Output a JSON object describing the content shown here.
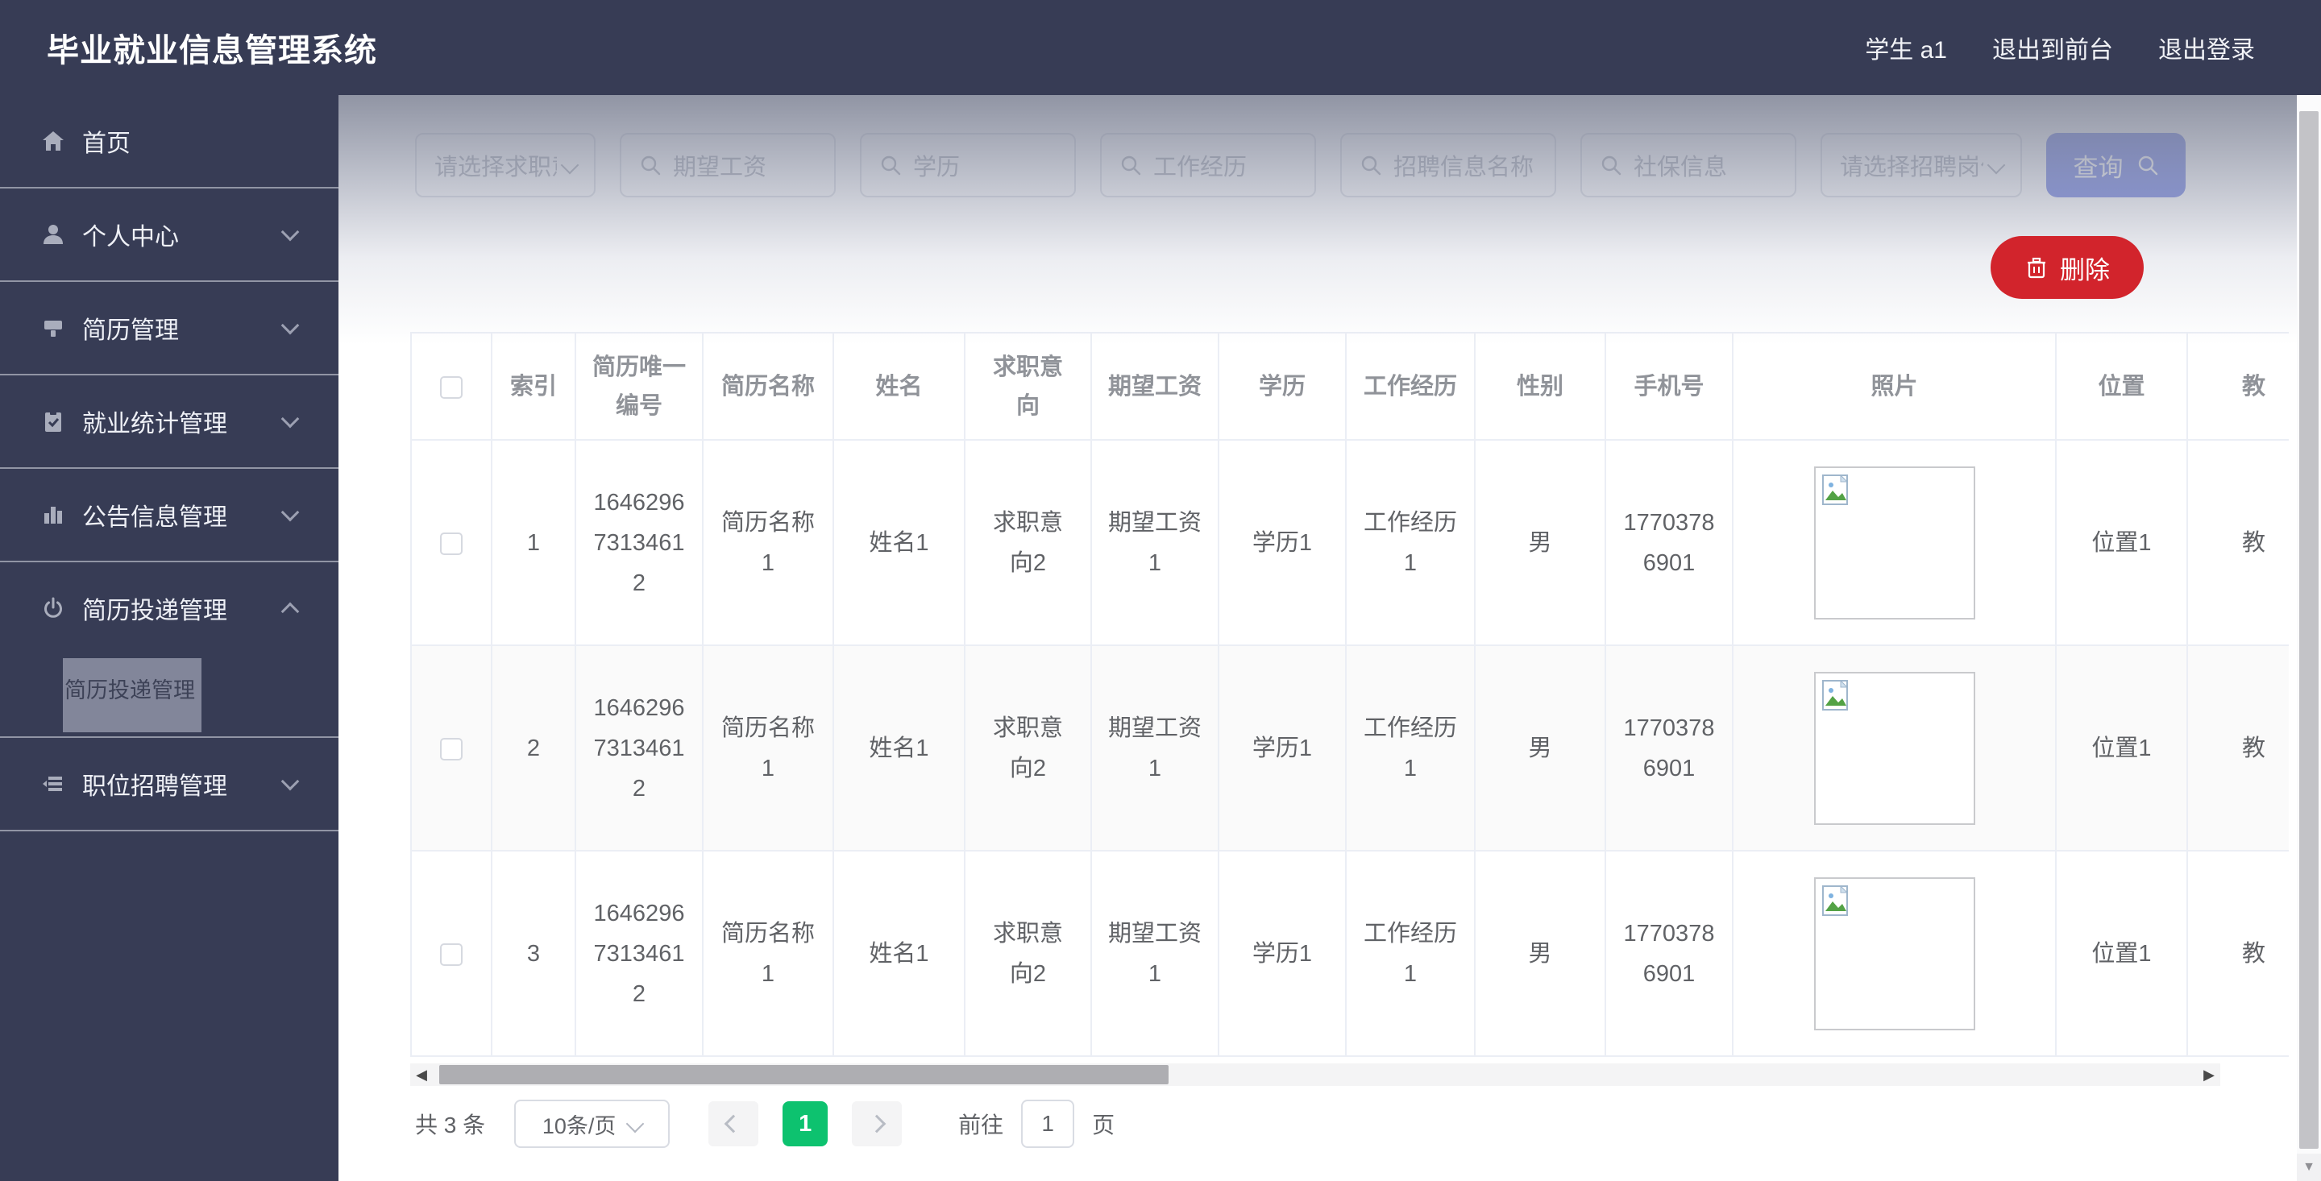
{
  "app_title": "毕业就业信息管理系统",
  "topbar": {
    "user": "学生 a1",
    "to_front": "退出到前台",
    "logout": "退出登录"
  },
  "sidebar": {
    "items": [
      {
        "label": "首页",
        "icon": "home-icon"
      },
      {
        "label": "个人中心",
        "icon": "user-icon"
      },
      {
        "label": "简历管理",
        "icon": "resume-icon"
      },
      {
        "label": "就业统计管理",
        "icon": "clipboard-check-icon"
      },
      {
        "label": "公告信息管理",
        "icon": "bar-chart-icon"
      },
      {
        "label": "简历投递管理",
        "icon": "power-icon",
        "expanded": true,
        "submenu": [
          {
            "label": "简历投递管理",
            "active": true
          }
        ]
      },
      {
        "label": "职位招聘管理",
        "icon": "list-icon"
      }
    ]
  },
  "filters": {
    "job_intent_placeholder": "请选择求职意向",
    "salary_placeholder": "期望工资",
    "education_placeholder": "学历",
    "work_exp_placeholder": "工作经历",
    "recruit_name_placeholder": "招聘信息名称",
    "social_security_placeholder": "社保信息",
    "recruit_post_placeholder": "请选择招聘岗位",
    "query_label": "查询"
  },
  "actions": {
    "delete_label": "删除"
  },
  "table": {
    "columns": [
      "索引",
      "简历唯一编号",
      "简历名称",
      "姓名",
      "求职意向",
      "期望工资",
      "学历",
      "工作经历",
      "性别",
      "手机号",
      "照片",
      "位置",
      "教"
    ],
    "rows": [
      {
        "index": "1",
        "resume_id": "164629673134612",
        "resume_name": "简历名称1",
        "name": "姓名1",
        "job_intent": "求职意向2",
        "salary": "期望工资1",
        "education": "学历1",
        "work_exp": "工作经历1",
        "gender": "男",
        "phone": "17703786901",
        "location": "位置1",
        "edu_cut": "教"
      },
      {
        "index": "2",
        "resume_id": "164629673134612",
        "resume_name": "简历名称1",
        "name": "姓名1",
        "job_intent": "求职意向2",
        "salary": "期望工资1",
        "education": "学历1",
        "work_exp": "工作经历1",
        "gender": "男",
        "phone": "17703786901",
        "location": "位置1",
        "edu_cut": "教"
      },
      {
        "index": "3",
        "resume_id": "164629673134612",
        "resume_name": "简历名称1",
        "name": "姓名1",
        "job_intent": "求职意向2",
        "salary": "期望工资1",
        "education": "学历1",
        "work_exp": "工作经历1",
        "gender": "男",
        "phone": "17703786901",
        "location": "位置1",
        "edu_cut": "教"
      }
    ]
  },
  "pagination": {
    "total": "共 3 条",
    "page_size": "10条/页",
    "current_page": "1",
    "goto_label": "前往",
    "goto_value": "1",
    "page_unit": "页"
  },
  "colors": {
    "header_bg": "#373c55",
    "primary_button": "#6476e0",
    "danger_button": "#d2242c",
    "pager_active": "#0dc26f"
  }
}
